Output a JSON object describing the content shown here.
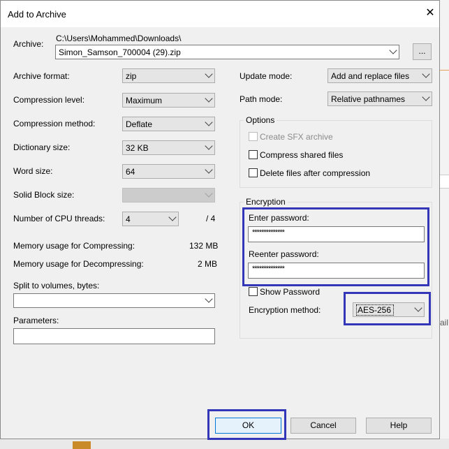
{
  "window": {
    "title": "Add to Archive"
  },
  "archive": {
    "label": "Archive:",
    "path": "C:\\Users\\Mohammed\\Downloads\\",
    "filename": "Simon_Samson_700004 (29).zip",
    "browse_label": "..."
  },
  "left": {
    "format": {
      "label": "Archive format:",
      "value": "zip"
    },
    "level": {
      "label": "Compression level:",
      "value": "Maximum"
    },
    "method": {
      "label": "Compression method:",
      "value": "Deflate"
    },
    "dict": {
      "label": "Dictionary size:",
      "value": "32 KB"
    },
    "word": {
      "label": "Word size:",
      "value": "64"
    },
    "solid": {
      "label": "Solid Block size:",
      "value": ""
    },
    "threads": {
      "label": "Number of CPU threads:",
      "value": "4",
      "max": "/ 4"
    },
    "mem_compress": {
      "label": "Memory usage for Compressing:",
      "value": "132 MB"
    },
    "mem_decompress": {
      "label": "Memory usage for Decompressing:",
      "value": "2 MB"
    },
    "split": {
      "label": "Split to volumes, bytes:",
      "value": ""
    },
    "params": {
      "label": "Parameters:",
      "value": ""
    }
  },
  "right": {
    "update": {
      "label": "Update mode:",
      "value": "Add and replace files"
    },
    "pathmode": {
      "label": "Path mode:",
      "value": "Relative pathnames"
    },
    "options": {
      "title": "Options",
      "sfx": "Create SFX archive",
      "shared": "Compress shared files",
      "delete": "Delete files after compression"
    },
    "encryption": {
      "title": "Encryption",
      "enter_label": "Enter password:",
      "enter_value": "**************",
      "reenter_label": "Reenter password:",
      "reenter_value": "**************",
      "show_label": "Show Password",
      "method_label": "Encryption method:",
      "method_value": "AES-256"
    }
  },
  "buttons": {
    "ok": "OK",
    "cancel": "Cancel",
    "help": "Help"
  },
  "background": {
    "peek_text": "ail"
  },
  "colors": {
    "highlight": "#3436b8",
    "dialog_bg": "#f0f0f0",
    "default_button_border": "#0078d7"
  }
}
